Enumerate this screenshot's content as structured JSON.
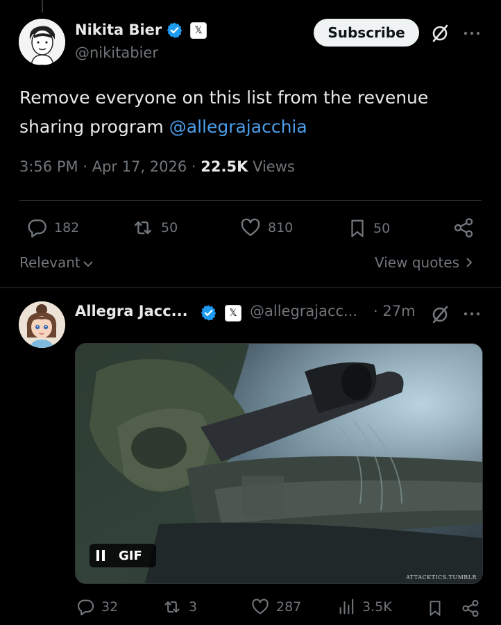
{
  "post": {
    "author_name": "Nikita Bier",
    "handle": "@nikitabier",
    "subscribe_label": "Subscribe",
    "text": "Remove everyone on this list from the revenue sharing program",
    "mention": "@allegrajacchia",
    "time": "3:56 PM",
    "date": "Apr 17, 2026",
    "views_count": "22.5K",
    "views_label": "Views",
    "separator": "·",
    "stats": {
      "replies": "182",
      "reposts": "50",
      "likes": "810",
      "bookmarks": "50"
    },
    "sort_label": "Relevant",
    "view_quotes_label": "View quotes"
  },
  "reply": {
    "author_name": "Allegra Jacc...",
    "handle": "@allegrajacc...",
    "time": "· 27m",
    "media": {
      "gif_label": "GIF",
      "watermark": "ATTACKTICS.TUMBLR"
    },
    "stats": {
      "replies": "32",
      "reposts": "3",
      "likes": "287",
      "views": "3.5K"
    }
  },
  "colors": {
    "background": "#000000",
    "text_primary": "#e7e9ea",
    "text_secondary": "#71767b",
    "link": "#4c9eea",
    "verified": "#1d9bf0",
    "divider": "#2f3336"
  },
  "icons": [
    "verified-badge-icon",
    "x-logo-icon",
    "grok-icon",
    "more-icon",
    "reply-icon",
    "repost-icon",
    "like-icon",
    "bookmark-icon",
    "share-icon",
    "chevron-down-icon",
    "chevron-right-icon",
    "views-icon",
    "pause-icon"
  ]
}
